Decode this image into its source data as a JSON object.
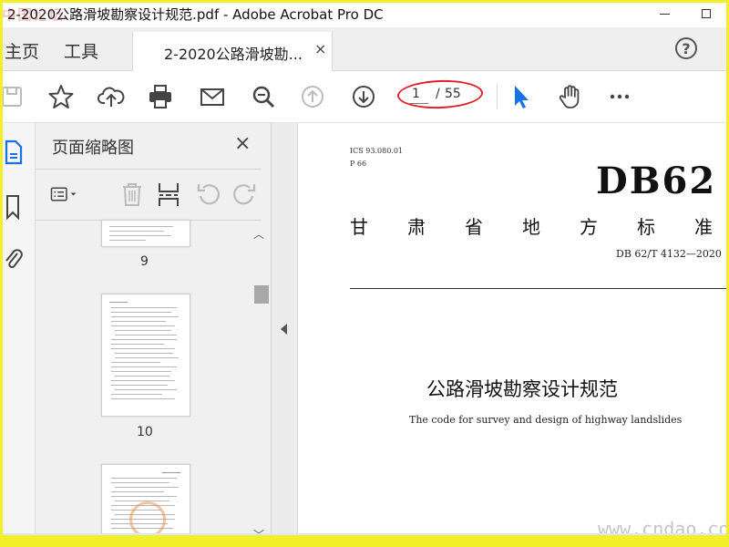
{
  "window": {
    "title": "2-2020公路滑坡勘察设计规范.pdf - Adobe Acrobat Pro DC",
    "corner_watermark": "中国论坛"
  },
  "tabs": {
    "home": "主页",
    "tools": "工具",
    "document": "2-2020公路滑坡勘...",
    "close": "×",
    "help": "?"
  },
  "toolbar": {
    "icons": [
      "save-icon",
      "bookmark-star-icon",
      "upload-cloud-icon",
      "print-icon",
      "email-icon",
      "zoom-search-icon",
      "page-up-icon",
      "page-down-icon",
      "select-arrow-icon",
      "hand-tool-icon",
      "more-icon"
    ],
    "page_current": "1",
    "page_separator": "/",
    "page_total": "55",
    "accent_color": "#1473e6",
    "annotation_color": "#e0202a"
  },
  "thumbnail_panel": {
    "title": "页面缩略图",
    "close": "×",
    "pages": [
      {
        "number": "9"
      },
      {
        "number": "10"
      }
    ]
  },
  "document": {
    "ics": "ICS 93.080.01",
    "classification": "P 66",
    "standard_code": "DB62",
    "province_chars": [
      "甘",
      "肃",
      "省",
      "地",
      "方",
      "标",
      "准"
    ],
    "number": "DB 62/T 4132—2020",
    "title_cn": "公路滑坡勘察设计规范",
    "title_en": "The code for survey and design of highway landslides"
  },
  "watermark": "www.cndao.com"
}
